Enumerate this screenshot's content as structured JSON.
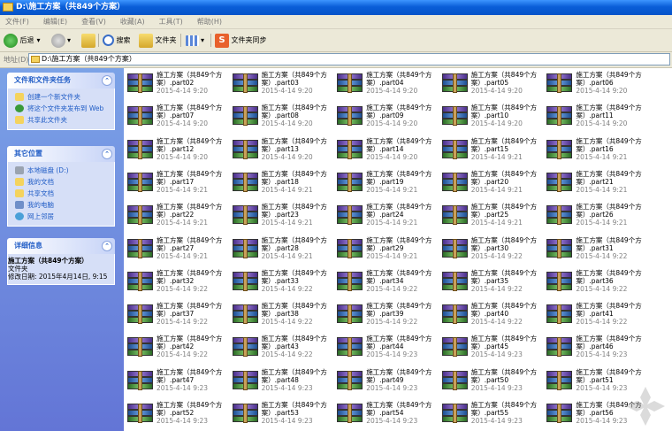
{
  "window": {
    "title": "D:\\施工方案（共849个方案）"
  },
  "menu": [
    "文件(F)",
    "编辑(E)",
    "查看(V)",
    "收藏(A)",
    "工具(T)",
    "帮助(H)"
  ],
  "toolbar": {
    "back": "后退",
    "search": "搜索",
    "folders": "文件夹",
    "sync": "文件夹同步"
  },
  "address": {
    "label": "地址(D)",
    "value": "D:\\施工方案（共849个方案）"
  },
  "sidebar": {
    "tasks": {
      "title": "文件和文件夹任务",
      "items": [
        "创建一个新文件夹",
        "将这个文件夹发布到 Web",
        "共享此文件夹"
      ]
    },
    "places": {
      "title": "其它位置",
      "items": [
        "本地磁盘 (D:)",
        "我的文档",
        "共享文档",
        "我的电脑",
        "网上邻居"
      ]
    },
    "details": {
      "title": "详细信息",
      "name": "施工方案（共849个方案）",
      "type": "文件夹",
      "modified": "修改日期: 2015年4月14日, 9:15"
    }
  },
  "files": [
    {
      "name": "施工方案（共849个方案）.part02",
      "date": "2015-4-14 9:20"
    },
    {
      "name": "施工方案（共849个方案）.part03",
      "date": "2015-4-14 9:20"
    },
    {
      "name": "施工方案（共849个方案）.part04",
      "date": "2015-4-14 9:20"
    },
    {
      "name": "施工方案（共849个方案）.part05",
      "date": "2015-4-14 9:20"
    },
    {
      "name": "施工方案（共849个方案）.part06",
      "date": "2015-4-14 9:20"
    },
    {
      "name": "施工方案（共849个方案）.part07",
      "date": "2015-4-14 9:20"
    },
    {
      "name": "施工方案（共849个方案）.part08",
      "date": "2015-4-14 9:20"
    },
    {
      "name": "施工方案（共849个方案）.part09",
      "date": "2015-4-14 9:20"
    },
    {
      "name": "施工方案（共849个方案）.part10",
      "date": "2015-4-14 9:20"
    },
    {
      "name": "施工方案（共849个方案）.part11",
      "date": "2015-4-14 9:20"
    },
    {
      "name": "施工方案（共849个方案）.part12",
      "date": "2015-4-14 9:20"
    },
    {
      "name": "施工方案（共849个方案）.part13",
      "date": "2015-4-14 9:20"
    },
    {
      "name": "施工方案（共849个方案）.part14",
      "date": "2015-4-14 9:20"
    },
    {
      "name": "施工方案（共849个方案）.part15",
      "date": "2015-4-14 9:21"
    },
    {
      "name": "施工方案（共849个方案）.part16",
      "date": "2015-4-14 9:21"
    },
    {
      "name": "施工方案（共849个方案）.part17",
      "date": "2015-4-14 9:21"
    },
    {
      "name": "施工方案（共849个方案）.part18",
      "date": "2015-4-14 9:21"
    },
    {
      "name": "施工方案（共849个方案）.part19",
      "date": "2015-4-14 9:21"
    },
    {
      "name": "施工方案（共849个方案）.part20",
      "date": "2015-4-14 9:21"
    },
    {
      "name": "施工方案（共849个方案）.part21",
      "date": "2015-4-14 9:21"
    },
    {
      "name": "施工方案（共849个方案）.part22",
      "date": "2015-4-14 9:21"
    },
    {
      "name": "施工方案（共849个方案）.part23",
      "date": "2015-4-14 9:21"
    },
    {
      "name": "施工方案（共849个方案）.part24",
      "date": "2015-4-14 9:21"
    },
    {
      "name": "施工方案（共849个方案）.part25",
      "date": "2015-4-14 9:21"
    },
    {
      "name": "施工方案（共849个方案）.part26",
      "date": "2015-4-14 9:21"
    },
    {
      "name": "施工方案（共849个方案）.part27",
      "date": "2015-4-14 9:21"
    },
    {
      "name": "施工方案（共849个方案）.part28",
      "date": "2015-4-14 9:21"
    },
    {
      "name": "施工方案（共849个方案）.part29",
      "date": "2015-4-14 9:21"
    },
    {
      "name": "施工方案（共849个方案）.part30",
      "date": "2015-4-14 9:22"
    },
    {
      "name": "施工方案（共849个方案）.part31",
      "date": "2015-4-14 9:22"
    },
    {
      "name": "施工方案（共849个方案）.part32",
      "date": "2015-4-14 9:22"
    },
    {
      "name": "施工方案（共849个方案）.part33",
      "date": "2015-4-14 9:22"
    },
    {
      "name": "施工方案（共849个方案）.part34",
      "date": "2015-4-14 9:22"
    },
    {
      "name": "施工方案（共849个方案）.part35",
      "date": "2015-4-14 9:22"
    },
    {
      "name": "施工方案（共849个方案）.part36",
      "date": "2015-4-14 9:22"
    },
    {
      "name": "施工方案（共849个方案）.part37",
      "date": "2015-4-14 9:22"
    },
    {
      "name": "施工方案（共849个方案）.part38",
      "date": "2015-4-14 9:22"
    },
    {
      "name": "施工方案（共849个方案）.part39",
      "date": "2015-4-14 9:22"
    },
    {
      "name": "施工方案（共849个方案）.part40",
      "date": "2015-4-14 9:22"
    },
    {
      "name": "施工方案（共849个方案）.part41",
      "date": "2015-4-14 9:22"
    },
    {
      "name": "施工方案（共849个方案）.part42",
      "date": "2015-4-14 9:22"
    },
    {
      "name": "施工方案（共849个方案）.part43",
      "date": "2015-4-14 9:22"
    },
    {
      "name": "施工方案（共849个方案）.part44",
      "date": "2015-4-14 9:23"
    },
    {
      "name": "施工方案（共849个方案）.part45",
      "date": "2015-4-14 9:23"
    },
    {
      "name": "施工方案（共849个方案）.part46",
      "date": "2015-4-14 9:23"
    },
    {
      "name": "施工方案（共849个方案）.part47",
      "date": "2015-4-14 9:23"
    },
    {
      "name": "施工方案（共849个方案）.part48",
      "date": "2015-4-14 9:23"
    },
    {
      "name": "施工方案（共849个方案）.part49",
      "date": "2015-4-14 9:23"
    },
    {
      "name": "施工方案（共849个方案）.part50",
      "date": "2015-4-14 9:23"
    },
    {
      "name": "施工方案（共849个方案）.part51",
      "date": "2015-4-14 9:23"
    },
    {
      "name": "施工方案（共849个方案）.part52",
      "date": "2015-4-14 9:23"
    },
    {
      "name": "施工方案（共849个方案）.part53",
      "date": "2015-4-14 9:23"
    },
    {
      "name": "施工方案（共849个方案）.part54",
      "date": "2015-4-14 9:23"
    },
    {
      "name": "施工方案（共849个方案）.part55",
      "date": "2015-4-14 9:23"
    },
    {
      "name": "施工方案（共849个方案）.part56",
      "date": "2015-4-14 9:23"
    }
  ]
}
